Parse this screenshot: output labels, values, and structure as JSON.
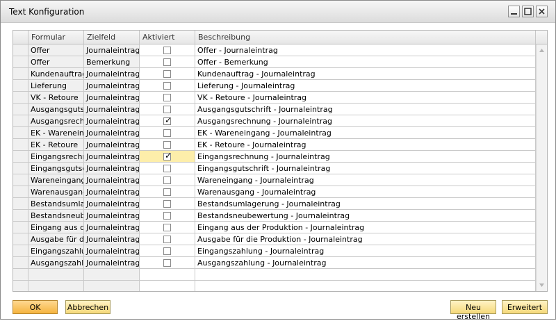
{
  "window": {
    "title": "Text Konfiguration"
  },
  "grid": {
    "columns": [
      "",
      "Formular",
      "Zielfeld",
      "Aktiviert",
      "Beschreibung"
    ],
    "rows": [
      {
        "formular": "Offer",
        "zielfeld": "Journaleintrag",
        "aktiviert": false,
        "beschreibung": "Offer - Journaleintrag"
      },
      {
        "formular": "Offer",
        "zielfeld": "Bemerkung",
        "aktiviert": false,
        "beschreibung": "Offer - Bemerkung"
      },
      {
        "formular": "Kundenauftrag",
        "zielfeld": "Journaleintrag",
        "aktiviert": false,
        "beschreibung": "Kundenauftrag - Journaleintrag"
      },
      {
        "formular": "Lieferung",
        "zielfeld": "Journaleintrag",
        "aktiviert": false,
        "beschreibung": "Lieferung - Journaleintrag"
      },
      {
        "formular": "VK - Retoure",
        "zielfeld": "Journaleintrag",
        "aktiviert": false,
        "beschreibung": "VK - Retoure - Journaleintrag"
      },
      {
        "formular": "Ausgangsgutsch",
        "zielfeld": "Journaleintrag",
        "aktiviert": false,
        "beschreibung": "Ausgangsgutschrift - Journaleintrag"
      },
      {
        "formular": "Ausgangsrechnu",
        "zielfeld": "Journaleintrag",
        "aktiviert": true,
        "beschreibung": "Ausgangsrechnung - Journaleintrag"
      },
      {
        "formular": "EK - Wareneinga",
        "zielfeld": "Journaleintrag",
        "aktiviert": false,
        "beschreibung": "EK - Wareneingang - Journaleintrag"
      },
      {
        "formular": "EK - Retoure",
        "zielfeld": "Journaleintrag",
        "aktiviert": false,
        "beschreibung": "EK - Retoure - Journaleintrag"
      },
      {
        "formular": "Eingangsrechnun",
        "zielfeld": "Journaleintrag",
        "aktiviert": true,
        "beschreibung": "Eingangsrechnung - Journaleintrag",
        "highlighted": true
      },
      {
        "formular": "Eingangsgutschr",
        "zielfeld": "Journaleintrag",
        "aktiviert": false,
        "beschreibung": "Eingangsgutschrift - Journaleintrag"
      },
      {
        "formular": "Wareneingang",
        "zielfeld": "Journaleintrag",
        "aktiviert": false,
        "beschreibung": "Wareneingang - Journaleintrag"
      },
      {
        "formular": "Warenausgang",
        "zielfeld": "Journaleintrag",
        "aktiviert": false,
        "beschreibung": "Warenausgang - Journaleintrag"
      },
      {
        "formular": "Bestandsumlager",
        "zielfeld": "Journaleintrag",
        "aktiviert": false,
        "beschreibung": "Bestandsumlagerung - Journaleintrag"
      },
      {
        "formular": "Bestandsneubew",
        "zielfeld": "Journaleintrag",
        "aktiviert": false,
        "beschreibung": "Bestandsneubewertung - Journaleintrag"
      },
      {
        "formular": "Eingang aus der",
        "zielfeld": "Journaleintrag",
        "aktiviert": false,
        "beschreibung": "Eingang aus der Produktion - Journaleintrag"
      },
      {
        "formular": "Ausgabe für die",
        "zielfeld": "Journaleintrag",
        "aktiviert": false,
        "beschreibung": "Ausgabe für die Produktion - Journaleintrag"
      },
      {
        "formular": "Eingangszahlung",
        "zielfeld": "Journaleintrag",
        "aktiviert": false,
        "beschreibung": "Eingangszahlung - Journaleintrag"
      },
      {
        "formular": "Ausgangszahlun",
        "zielfeld": "Journaleintrag",
        "aktiviert": false,
        "beschreibung": "Ausgangszahlung - Journaleintrag"
      },
      {
        "formular": "",
        "zielfeld": "",
        "aktiviert": null,
        "beschreibung": ""
      },
      {
        "formular": "",
        "zielfeld": "",
        "aktiviert": null,
        "beschreibung": ""
      }
    ]
  },
  "buttons": {
    "ok": "OK",
    "cancel": "Abbrechen",
    "new": "Neu erstellen",
    "advanced": "Erweitert"
  },
  "colors": {
    "button_bg": "#f5d97a",
    "ok_bg": "#f5b440",
    "highlight": "#fdeeaa",
    "readonly_cell": "#f0f0f0"
  },
  "icons": [
    "minimize-icon",
    "maximize-icon",
    "close-icon",
    "scroll-up-icon",
    "scroll-down-icon",
    "checkmark-icon"
  ]
}
